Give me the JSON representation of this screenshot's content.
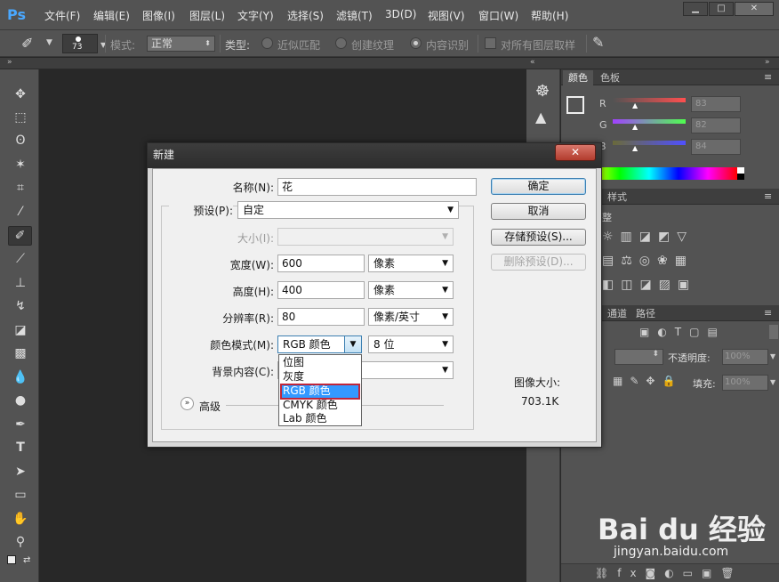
{
  "app": {
    "logo": "Ps"
  },
  "menu": [
    "文件(F)",
    "编辑(E)",
    "图像(I)",
    "图层(L)",
    "文字(Y)",
    "选择(S)",
    "滤镜(T)",
    "3D(D)",
    "视图(V)",
    "窗口(W)",
    "帮助(H)"
  ],
  "window_controls": {
    "minimize": "▁",
    "maximize": "□",
    "close": "✕"
  },
  "options": {
    "brush_size": "73",
    "mode_label": "模式:",
    "mode_value": "正常",
    "type_label": "类型:",
    "type_options": [
      "近似匹配",
      "创建纹理",
      "内容识别"
    ],
    "type_selected": "内容识别",
    "sample_all_label": "对所有图层取样"
  },
  "panels": {
    "color_tabs": [
      "颜色",
      "色板"
    ],
    "rgb": [
      {
        "channel": "R",
        "value": "83"
      },
      {
        "channel": "G",
        "value": "82"
      },
      {
        "channel": "B",
        "value": "84"
      }
    ],
    "styles_tab": "样式",
    "adjust_label": "整",
    "layer_tabs": [
      "通道",
      "路径"
    ],
    "opacity_label": "不透明度:",
    "opacity_value": "100%",
    "fill_label": "填充:",
    "fill_value": "100%"
  },
  "dialog": {
    "title": "新建",
    "close": "✕",
    "fields": {
      "name_label": "名称(N):",
      "name_value": "花",
      "preset_label": "预设(P):",
      "preset_value": "自定",
      "size_label": "大小(I):",
      "width_label": "宽度(W):",
      "width_value": "600",
      "width_unit": "像素",
      "height_label": "高度(H):",
      "height_value": "400",
      "height_unit": "像素",
      "resolution_label": "分辨率(R):",
      "resolution_value": "80",
      "resolution_unit": "像素/英寸",
      "color_mode_label": "颜色模式(M):",
      "color_mode_value": "RGB 颜色",
      "bit_depth": "8 位",
      "background_label": "背景内容(C):",
      "advanced_label": "高级"
    },
    "color_mode_options": [
      "位图",
      "灰度",
      "RGB 颜色",
      "CMYK 颜色",
      "Lab 颜色"
    ],
    "highlighted_option": "RGB 颜色",
    "buttons": {
      "ok": "确定",
      "cancel": "取消",
      "save_preset": "存储预设(S)...",
      "delete_preset": "删除预设(D)..."
    },
    "image_size_label": "图像大小:",
    "image_size_value": "703.1K"
  },
  "watermark": {
    "logo_text": "Bai du 经验",
    "url": "jingyan.baidu.com"
  },
  "colors": {
    "accent": "#3399ff",
    "highlight_border": "#c0263a",
    "close_red": "#c4473a",
    "ps_blue": "#4aa8ff"
  }
}
